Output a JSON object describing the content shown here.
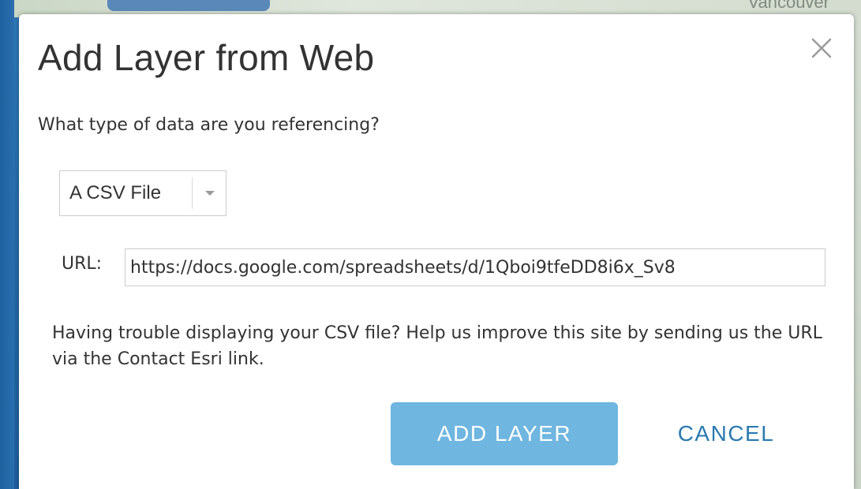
{
  "background": {
    "map_city_label": "Vancouver"
  },
  "dialog": {
    "title": "Add Layer from Web",
    "close_icon": "close-icon",
    "question": "What type of data are you referencing?",
    "data_type_select": {
      "selected": "A CSV File",
      "chevron_icon": "chevron-down-icon"
    },
    "url": {
      "label": "URL:",
      "value": "https://docs.google.com/spreadsheets/d/1Qboi9tfeDD8i6x_Sv8"
    },
    "help_text": "Having trouble displaying your CSV file? Help us improve this site by sending us the URL via the Contact Esri link.",
    "buttons": {
      "add_label": "ADD LAYER",
      "cancel_label": "CANCEL"
    }
  },
  "colors": {
    "primary_button": "#6fb6e0",
    "link_button": "#2a7ab0",
    "text": "#333333"
  }
}
